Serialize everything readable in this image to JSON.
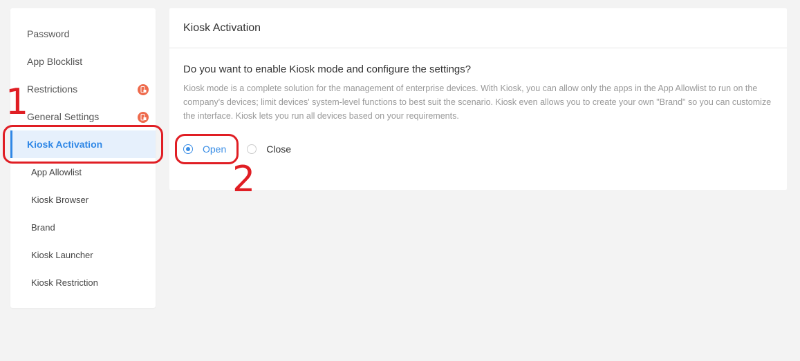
{
  "sidebar": {
    "items": [
      {
        "label": "Password"
      },
      {
        "label": "App Blocklist"
      },
      {
        "label": "Restrictions",
        "badge": true
      },
      {
        "label": "General Settings",
        "badge": true
      },
      {
        "label": "Kiosk Activation",
        "active": true
      },
      {
        "label": "App Allowlist"
      },
      {
        "label": "Kiosk Browser"
      },
      {
        "label": "Brand"
      },
      {
        "label": "Kiosk Launcher"
      },
      {
        "label": "Kiosk Restriction"
      }
    ]
  },
  "panel": {
    "title": "Kiosk Activation",
    "question": "Do you want to enable Kiosk mode and configure the settings?",
    "description": "Kiosk mode is a complete solution for the management of enterprise devices. With Kiosk, you can allow only the apps in the App Allowlist to run on the company's devices; limit devices' system-level functions to best suit the scenario. Kiosk even allows you to create your own \"Brand\" so you can customize the interface. Kiosk lets you run all devices based on your requirements.",
    "options": {
      "open": "Open",
      "close": "Close",
      "selected": "Open"
    }
  },
  "annotations": {
    "step1": "1",
    "step2": "2"
  },
  "colors": {
    "accent": "#3a8ee6",
    "annotation": "#e01e24",
    "badge": "#ee6b4d"
  }
}
